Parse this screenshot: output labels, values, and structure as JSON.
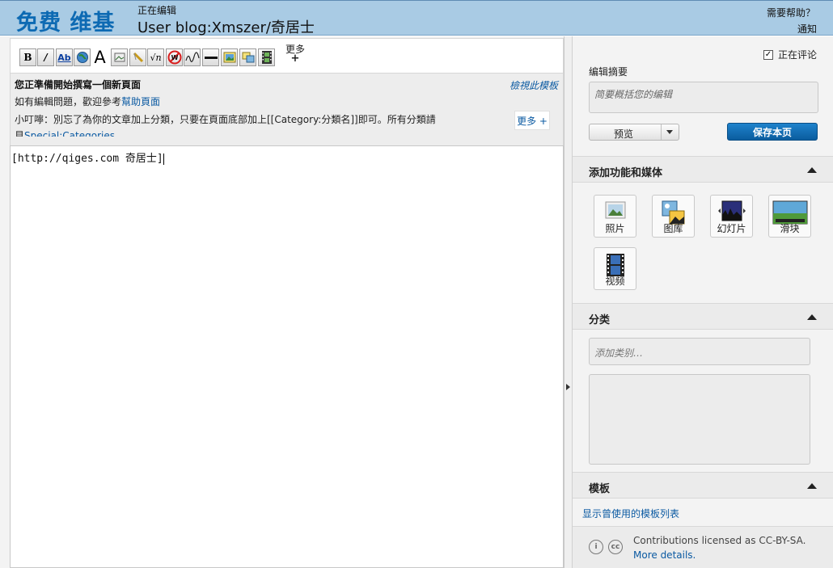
{
  "header": {
    "logo": "免费 维基",
    "editing_label": "正在编辑",
    "page_name": "User blog:Xmszer/奇居士",
    "help": "需要帮助？",
    "notify": "通知"
  },
  "toolbar": {
    "buttons": [
      {
        "label": "B",
        "icon": "bold-icon"
      },
      {
        "label": "I",
        "icon": "italic-icon"
      },
      {
        "label": "Ab",
        "icon": "internal-link-icon"
      },
      {
        "label": "",
        "icon": "external-link-icon"
      },
      {
        "label": "A",
        "icon": "headline-icon"
      },
      {
        "label": "",
        "icon": "embedded-file-icon"
      },
      {
        "label": "",
        "icon": "media-file-icon"
      },
      {
        "label": "√n",
        "icon": "math-formula-icon"
      },
      {
        "label": "W",
        "icon": "nowiki-icon"
      },
      {
        "label": "",
        "icon": "signature-icon"
      },
      {
        "label": "—",
        "icon": "horizontal-line-icon"
      },
      {
        "label": "",
        "icon": "image-icon"
      },
      {
        "label": "",
        "icon": "gallery-icon"
      },
      {
        "label": "",
        "icon": "video-icon"
      }
    ],
    "more": "更多",
    "more_plus": "+"
  },
  "notice": {
    "title": "您正準備開始撰寫一個新頁面",
    "line1_prefix": "如有編輯問題，歡迎參考",
    "line1_link": "幫助頁面",
    "line2": "小叮嚀：別忘了為你的文章加上分類，只要在頁面底部加上[[Category:分類名]]即可。所有分類請",
    "line3_prefix": "見",
    "line3_link": "Special:Categories",
    "view_template": "檢視此模板",
    "more": "更多 +"
  },
  "editor": {
    "content": "[http://qiges.com 奇居士]"
  },
  "rail": {
    "watch_label": "正在评论",
    "watch_checked": "✓",
    "summary_label": "编辑摘要",
    "summary_placeholder": "简要概括您的编辑",
    "preview": "预览",
    "save": "保存本页",
    "media_section": "添加功能和媒体",
    "media": [
      {
        "label": "照片",
        "icon": "photo-icon"
      },
      {
        "label": "图库",
        "icon": "gallery-icon"
      },
      {
        "label": "幻灯片",
        "icon": "slideshow-icon"
      },
      {
        "label": "滑块",
        "icon": "slider-icon"
      },
      {
        "label": "视频",
        "icon": "video-icon"
      }
    ],
    "category_section": "分类",
    "category_placeholder": "添加类别…",
    "template_section": "模板",
    "template_link": "显示曾使用的模板列表",
    "license_text": "Contributions licensed as CC-BY-SA.",
    "license_more": "More details.",
    "license_icon_1": "i",
    "license_icon_2": "cc"
  },
  "colors": {
    "header_bg": "#a9cbe4",
    "logo": "#0d6ab3",
    "link": "#0b5aa2",
    "save_button": "#0a6ab3"
  }
}
